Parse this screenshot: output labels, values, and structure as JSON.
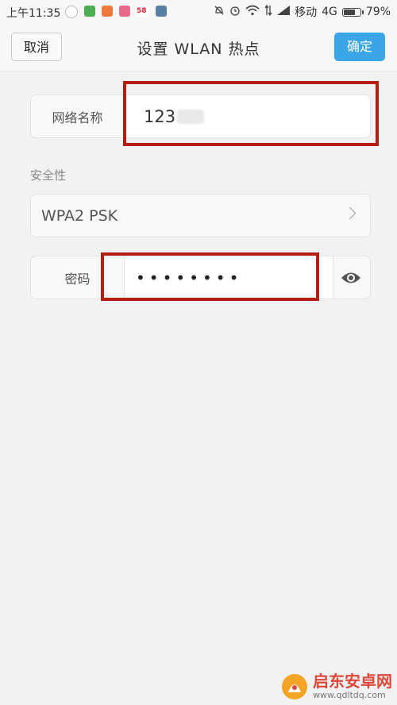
{
  "status_bar": {
    "time": "上午11:35",
    "carrier": "移动",
    "network": "4G",
    "battery": "79%",
    "battery_level": 0.79,
    "icons": [
      "moon-icon",
      "app-icon",
      "mail-icon",
      "app-icon",
      "58-icon",
      "app-icon"
    ],
    "notif_icon_58": "58",
    "right_icons": [
      "bell-off-icon",
      "alarm-icon",
      "wifi-icon",
      "data-arrows-icon",
      "signal-icon"
    ]
  },
  "header": {
    "cancel_label": "取消",
    "title": "设置 WLAN 热点",
    "confirm_label": "确定",
    "confirm_color": "#3aa6e8"
  },
  "network_name": {
    "label": "网络名称",
    "value": "123"
  },
  "security": {
    "section_label": "安全性",
    "selected": "WPA2 PSK"
  },
  "password": {
    "label": "密码",
    "value": "••••••••"
  },
  "annotation_color": "#b41c14",
  "watermark": {
    "brand": "启东安卓网",
    "url": "www.qdltdq.com"
  }
}
